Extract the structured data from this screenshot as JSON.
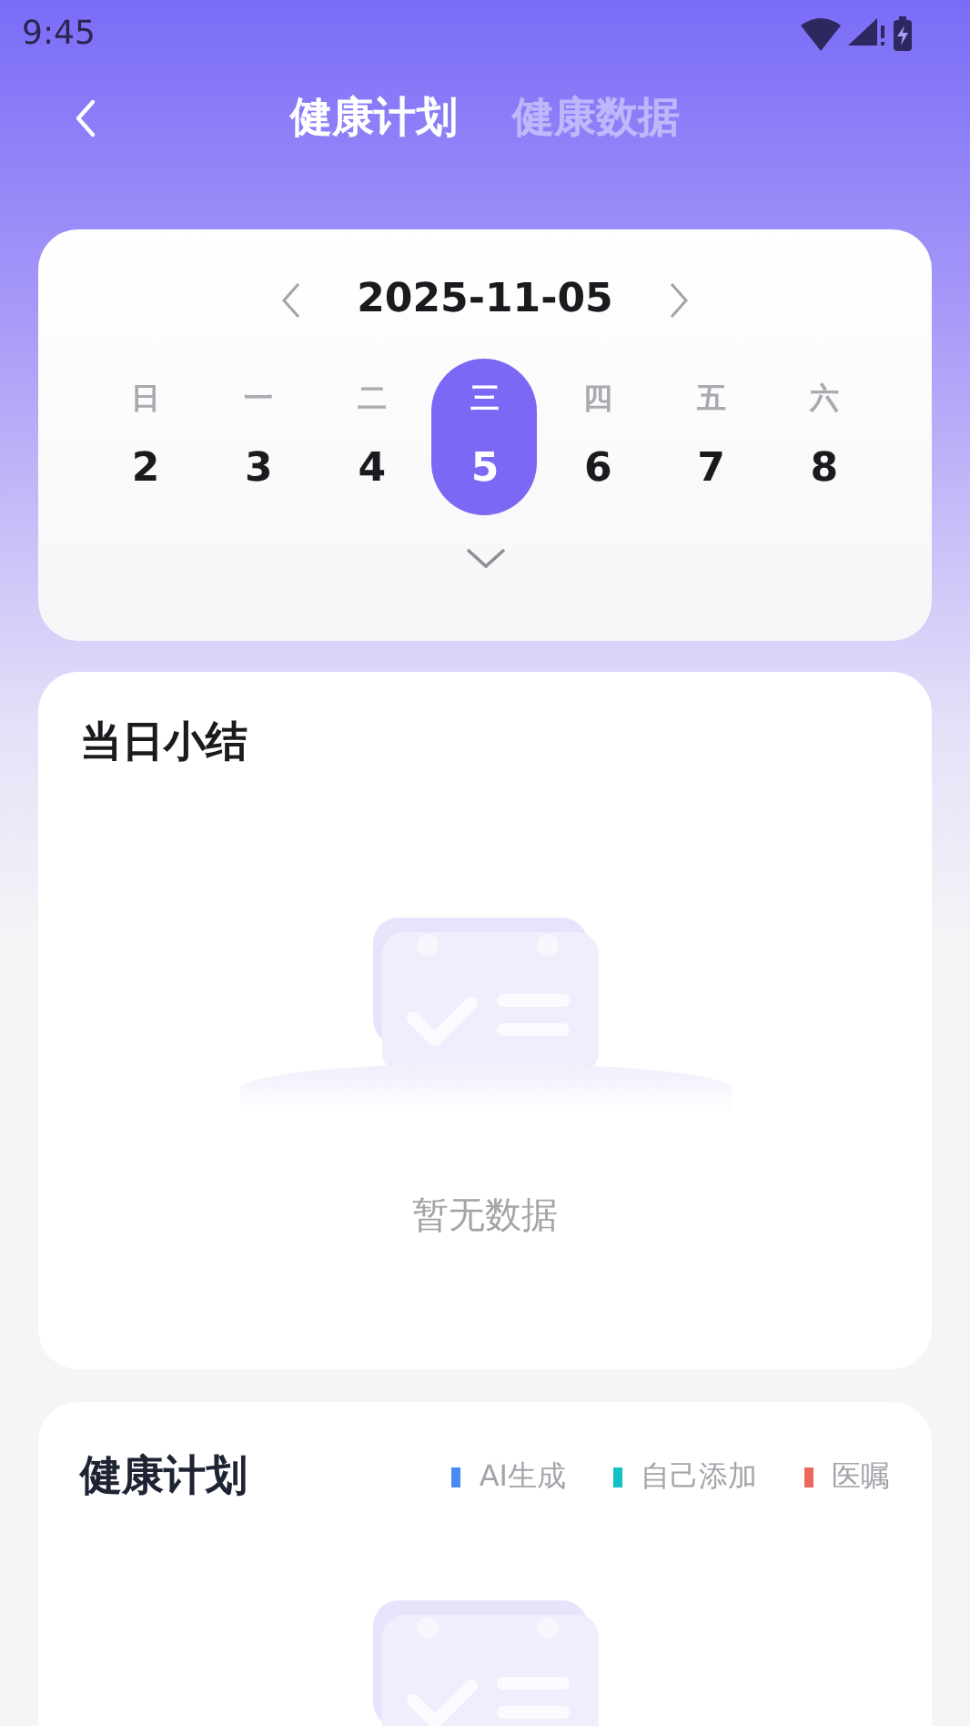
{
  "status_bar": {
    "time": "9:45"
  },
  "header": {
    "tabs": [
      {
        "label": "健康计划",
        "selected": true
      },
      {
        "label": "健康数据",
        "selected": false
      }
    ]
  },
  "calendar": {
    "date": "2025-11-05",
    "days": [
      {
        "weekday": "日",
        "day": "2",
        "selected": false
      },
      {
        "weekday": "一",
        "day": "3",
        "selected": false
      },
      {
        "weekday": "二",
        "day": "4",
        "selected": false
      },
      {
        "weekday": "三",
        "day": "5",
        "selected": true
      },
      {
        "weekday": "四",
        "day": "6",
        "selected": false
      },
      {
        "weekday": "五",
        "day": "7",
        "selected": false
      },
      {
        "weekday": "六",
        "day": "8",
        "selected": false
      }
    ]
  },
  "summary": {
    "title": "当日小结",
    "empty_text": "暂无数据"
  },
  "plan": {
    "title": "健康计划",
    "legend": [
      {
        "label": "AI生成",
        "color": "#4a8af4"
      },
      {
        "label": "自己添加",
        "color": "#12c2c2"
      },
      {
        "label": "医嘱",
        "color": "#e9675c"
      }
    ]
  }
}
